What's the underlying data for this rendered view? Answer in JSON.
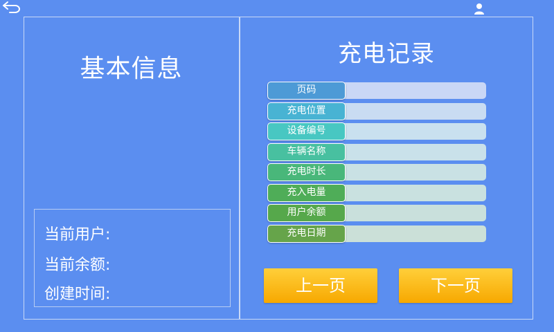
{
  "header": {
    "back_icon": "back-arrow-icon",
    "user_icon": "user-icon"
  },
  "basic_info": {
    "title": "基本信息",
    "current_user_label": "当前用户:",
    "balance_label": "当前余额:",
    "created_label": "创建时间:"
  },
  "records": {
    "title": "充电记录",
    "fields": [
      {
        "label": "页码",
        "value": "",
        "color": "#4d9ad6"
      },
      {
        "label": "充电位置",
        "value": "",
        "color": "#48b3d3"
      },
      {
        "label": "设备编号",
        "value": "",
        "color": "#48c7c2"
      },
      {
        "label": "车辆名称",
        "value": "",
        "color": "#48c0a0"
      },
      {
        "label": "充电时长",
        "value": "",
        "color": "#49b77a"
      },
      {
        "label": "充入电量",
        "value": "",
        "color": "#4fad58"
      },
      {
        "label": "用户余额",
        "value": "",
        "color": "#56a84b"
      },
      {
        "label": "充电日期",
        "value": "",
        "color": "#66a44a"
      }
    ],
    "value_colors": [
      "#c9d7f6",
      "#c9dcf2",
      "#c9e0ef",
      "#c9e1ea",
      "#c9e1e4",
      "#c9e1e0",
      "#c9e0dc",
      "#cbe0d8"
    ]
  },
  "pagination": {
    "prev_label": "上一页",
    "next_label": "下一页"
  }
}
